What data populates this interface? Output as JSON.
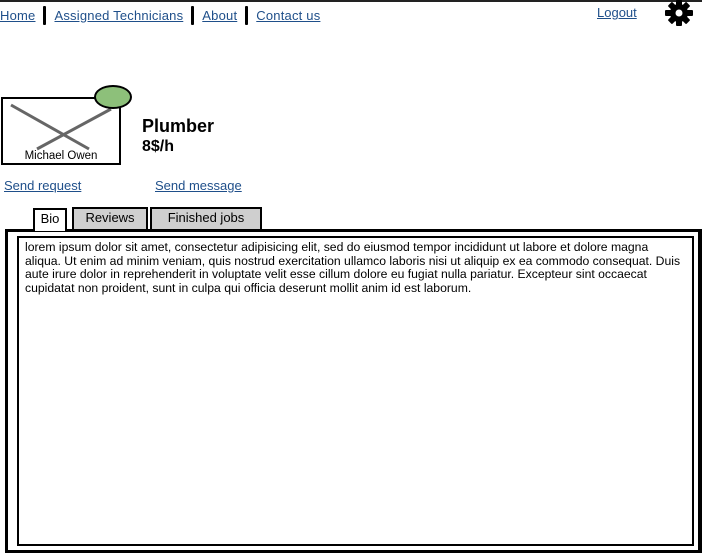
{
  "nav": {
    "items": [
      {
        "label": "Home"
      },
      {
        "label": "Assigned Technicians"
      },
      {
        "label": "About"
      },
      {
        "label": "Contact us"
      }
    ],
    "logout": "Logout"
  },
  "profile": {
    "name": "Michael Owen",
    "profession": "Plumber",
    "rate": "8$/h",
    "status_color": "#8dc07a"
  },
  "actions": {
    "send_request": "Send request",
    "send_message": "Send message"
  },
  "tabs": [
    {
      "label": "Bio",
      "active": true
    },
    {
      "label": "Reviews",
      "active": false
    },
    {
      "label": "Finished jobs",
      "active": false
    }
  ],
  "bio": {
    "text": "lorem ipsum dolor sit amet, consectetur adipisicing elit, sed do eiusmod tempor incididunt ut labore et dolore magna aliqua. Ut enim ad minim veniam, quis nostrud exercitation ullamco laboris nisi ut aliquip ex ea commodo consequat. Duis aute irure dolor in reprehenderit in voluptate velit esse cillum dolore eu fugiat nulla pariatur. Excepteur sint occaecat cupidatat non proident, sunt in culpa qui officia deserunt mollit anim id est laborum."
  }
}
